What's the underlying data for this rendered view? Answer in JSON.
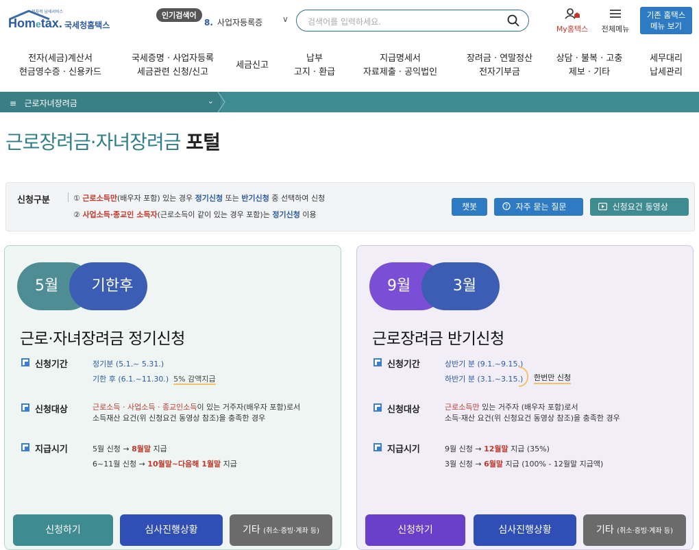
{
  "header": {
    "logo_small": "전자적 납세서비스",
    "logo_main": "Hom",
    "logo_e": "e",
    "logo_tax": "tax.",
    "logo_kr": "국세청홈택스",
    "popular_badge": "인기검색어",
    "popular_rank": "8.",
    "popular_term": "사업자등록증",
    "search_placeholder": "검색어를 입력하세요.",
    "my_home_label": "My홈택스",
    "all_menu_label": "전체메뉴",
    "old_menu_line1": "기존 홈택스",
    "old_menu_line2": "메뉴 보기"
  },
  "gnb": [
    {
      "line1": "전자(세금)계산서",
      "line2": "현금영수증 · 신용카드"
    },
    {
      "line1": "국세증명 · 사업자등록",
      "line2": "세금관련 신청/신고"
    },
    {
      "line1": "세금신고",
      "line2": ""
    },
    {
      "line1": "납부",
      "line2": "고지 · 환급"
    },
    {
      "line1": "지급명세서",
      "line2": "자료제출 · 공익법인"
    },
    {
      "line1": "장려금 · 연말정산",
      "line2": "전자기부금"
    },
    {
      "line1": "상담 · 불복 · 고충",
      "line2": "제보 · 기타"
    },
    {
      "line1": "세무대리",
      "line2": "납세관리"
    }
  ],
  "breadcrumb": {
    "menu_glyph": "≡",
    "label": "근로자녀장려금",
    "chevron": "⌄"
  },
  "page_title": {
    "colored": "근로장려금·자녀장려금",
    "bold": "포털"
  },
  "notice": {
    "label": "신청구분",
    "line1": {
      "num": "①",
      "red1": "근로소득만",
      "t1": "(배우자 포함) 있는 경우",
      "blue1": "정기신청",
      "t2": "또는",
      "blue2": "반기신청",
      "t3": "중 선택하여 신청"
    },
    "line2": {
      "num": "②",
      "red1": "사업소득·종교인 소득자",
      "t1": "(근로소득이 같이 있는 경우 포함)는",
      "blue1": "정기신청",
      "t2": "이용"
    },
    "btn_chat": "챗봇",
    "btn_faq": "자주 묻는 질문",
    "btn_video": "신청요건 동영상"
  },
  "card_regular": {
    "pill_a": "5월",
    "pill_b": "기한후",
    "title": "근로·자녀장려금 정기신청",
    "period_key": "신청기간",
    "period_1": "정기분 (5.1.~ 5.31.)",
    "period_2": "기한 후 (6.1.~11.30.)",
    "period_2_note": "5% 감액지급",
    "target_key": "신청대상",
    "target_red": "근로소득 · 사업소득 · 종교인소득",
    "target_t1": "이 있는 거주자(배우자 포함)로서",
    "target_t2": "소득재산 요건(위 신청요건 동영상 참조)을 충족한 경우",
    "pay_key": "지급시기",
    "pay_1a": "5월 신청 →",
    "pay_1r": "8월말",
    "pay_1b": "지급",
    "pay_2a": "6~11월 신청 →",
    "pay_2r": "10월말~다음해 1월말",
    "pay_2b": "지급",
    "btn_apply": "신청하기",
    "btn_status": "심사진행상황",
    "btn_other": "기타",
    "btn_other_small": "(취소·증빙·계좌 등)"
  },
  "card_half": {
    "pill_a": "9월",
    "pill_b": "3월",
    "title": "근로장려금 반기신청",
    "period_key": "신청기간",
    "period_1": "상반기 분 (9.1.~9.15.)",
    "period_2": "하반기 분 (3.1.~3.15.)",
    "once_note": "한번만 신청",
    "target_key": "신청대상",
    "target_red": "근로소득만",
    "target_t1": "있는 거주자 (배우자 포함)로서",
    "target_t2": "소득·재산 요건(위 신청요건 동영상 참조)을 충족한 경우",
    "pay_key": "지급시기",
    "pay_1a": "9월 신청 →",
    "pay_1r": "12월말",
    "pay_1b": "지급 (35%)",
    "pay_2a": "3월 신청 →",
    "pay_2r": "6월말",
    "pay_2b": "지급 (100% - 12월말 지급액)",
    "btn_apply": "신청하기",
    "btn_status": "심사진행상황",
    "btn_other": "기타",
    "btn_other_small": "(취소·증빙·계좌 등)"
  },
  "colors": {
    "teal": "#3f8b92",
    "blue": "#2e7bc4",
    "red_text": "#c0392b",
    "purple": "#6a3fc9",
    "navy_button": "#2f4fb6",
    "gray_button": "#6b6b6b"
  }
}
